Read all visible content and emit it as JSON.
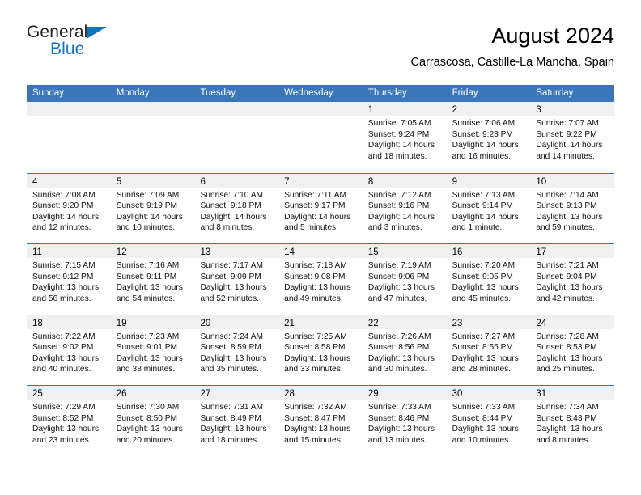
{
  "brand": {
    "name_top": "General",
    "name_bottom": "Blue",
    "accent_color": "#1275bc",
    "text_color": "#231f20"
  },
  "header": {
    "title": "August 2024",
    "subtitle": "Carrascosa, Castille-La Mancha, Spain"
  },
  "theme": {
    "header_row_color": "#3A76B8",
    "day_band_color": "#f0f0f0",
    "row_divider_color": "#3A76B8",
    "page_background": "#ffffff"
  },
  "weekdays": [
    "Sunday",
    "Monday",
    "Tuesday",
    "Wednesday",
    "Thursday",
    "Friday",
    "Saturday"
  ],
  "weeks": [
    [
      {
        "day": "",
        "lines": []
      },
      {
        "day": "",
        "lines": []
      },
      {
        "day": "",
        "lines": []
      },
      {
        "day": "",
        "lines": []
      },
      {
        "day": "1",
        "lines": [
          "Sunrise: 7:05 AM",
          "Sunset: 9:24 PM",
          "Daylight: 14 hours",
          "and 18 minutes."
        ]
      },
      {
        "day": "2",
        "lines": [
          "Sunrise: 7:06 AM",
          "Sunset: 9:23 PM",
          "Daylight: 14 hours",
          "and 16 minutes."
        ]
      },
      {
        "day": "3",
        "lines": [
          "Sunrise: 7:07 AM",
          "Sunset: 9:22 PM",
          "Daylight: 14 hours",
          "and 14 minutes."
        ]
      }
    ],
    [
      {
        "day": "4",
        "lines": [
          "Sunrise: 7:08 AM",
          "Sunset: 9:20 PM",
          "Daylight: 14 hours",
          "and 12 minutes."
        ]
      },
      {
        "day": "5",
        "lines": [
          "Sunrise: 7:09 AM",
          "Sunset: 9:19 PM",
          "Daylight: 14 hours",
          "and 10 minutes."
        ]
      },
      {
        "day": "6",
        "lines": [
          "Sunrise: 7:10 AM",
          "Sunset: 9:18 PM",
          "Daylight: 14 hours",
          "and 8 minutes."
        ]
      },
      {
        "day": "7",
        "lines": [
          "Sunrise: 7:11 AM",
          "Sunset: 9:17 PM",
          "Daylight: 14 hours",
          "and 5 minutes."
        ]
      },
      {
        "day": "8",
        "lines": [
          "Sunrise: 7:12 AM",
          "Sunset: 9:16 PM",
          "Daylight: 14 hours",
          "and 3 minutes."
        ]
      },
      {
        "day": "9",
        "lines": [
          "Sunrise: 7:13 AM",
          "Sunset: 9:14 PM",
          "Daylight: 14 hours",
          "and 1 minute."
        ]
      },
      {
        "day": "10",
        "lines": [
          "Sunrise: 7:14 AM",
          "Sunset: 9:13 PM",
          "Daylight: 13 hours",
          "and 59 minutes."
        ]
      }
    ],
    [
      {
        "day": "11",
        "lines": [
          "Sunrise: 7:15 AM",
          "Sunset: 9:12 PM",
          "Daylight: 13 hours",
          "and 56 minutes."
        ]
      },
      {
        "day": "12",
        "lines": [
          "Sunrise: 7:16 AM",
          "Sunset: 9:11 PM",
          "Daylight: 13 hours",
          "and 54 minutes."
        ]
      },
      {
        "day": "13",
        "lines": [
          "Sunrise: 7:17 AM",
          "Sunset: 9:09 PM",
          "Daylight: 13 hours",
          "and 52 minutes."
        ]
      },
      {
        "day": "14",
        "lines": [
          "Sunrise: 7:18 AM",
          "Sunset: 9:08 PM",
          "Daylight: 13 hours",
          "and 49 minutes."
        ]
      },
      {
        "day": "15",
        "lines": [
          "Sunrise: 7:19 AM",
          "Sunset: 9:06 PM",
          "Daylight: 13 hours",
          "and 47 minutes."
        ]
      },
      {
        "day": "16",
        "lines": [
          "Sunrise: 7:20 AM",
          "Sunset: 9:05 PM",
          "Daylight: 13 hours",
          "and 45 minutes."
        ]
      },
      {
        "day": "17",
        "lines": [
          "Sunrise: 7:21 AM",
          "Sunset: 9:04 PM",
          "Daylight: 13 hours",
          "and 42 minutes."
        ]
      }
    ],
    [
      {
        "day": "18",
        "lines": [
          "Sunrise: 7:22 AM",
          "Sunset: 9:02 PM",
          "Daylight: 13 hours",
          "and 40 minutes."
        ]
      },
      {
        "day": "19",
        "lines": [
          "Sunrise: 7:23 AM",
          "Sunset: 9:01 PM",
          "Daylight: 13 hours",
          "and 38 minutes."
        ]
      },
      {
        "day": "20",
        "lines": [
          "Sunrise: 7:24 AM",
          "Sunset: 8:59 PM",
          "Daylight: 13 hours",
          "and 35 minutes."
        ]
      },
      {
        "day": "21",
        "lines": [
          "Sunrise: 7:25 AM",
          "Sunset: 8:58 PM",
          "Daylight: 13 hours",
          "and 33 minutes."
        ]
      },
      {
        "day": "22",
        "lines": [
          "Sunrise: 7:26 AM",
          "Sunset: 8:56 PM",
          "Daylight: 13 hours",
          "and 30 minutes."
        ]
      },
      {
        "day": "23",
        "lines": [
          "Sunrise: 7:27 AM",
          "Sunset: 8:55 PM",
          "Daylight: 13 hours",
          "and 28 minutes."
        ]
      },
      {
        "day": "24",
        "lines": [
          "Sunrise: 7:28 AM",
          "Sunset: 8:53 PM",
          "Daylight: 13 hours",
          "and 25 minutes."
        ]
      }
    ],
    [
      {
        "day": "25",
        "lines": [
          "Sunrise: 7:29 AM",
          "Sunset: 8:52 PM",
          "Daylight: 13 hours",
          "and 23 minutes."
        ]
      },
      {
        "day": "26",
        "lines": [
          "Sunrise: 7:30 AM",
          "Sunset: 8:50 PM",
          "Daylight: 13 hours",
          "and 20 minutes."
        ]
      },
      {
        "day": "27",
        "lines": [
          "Sunrise: 7:31 AM",
          "Sunset: 8:49 PM",
          "Daylight: 13 hours",
          "and 18 minutes."
        ]
      },
      {
        "day": "28",
        "lines": [
          "Sunrise: 7:32 AM",
          "Sunset: 8:47 PM",
          "Daylight: 13 hours",
          "and 15 minutes."
        ]
      },
      {
        "day": "29",
        "lines": [
          "Sunrise: 7:33 AM",
          "Sunset: 8:46 PM",
          "Daylight: 13 hours",
          "and 13 minutes."
        ]
      },
      {
        "day": "30",
        "lines": [
          "Sunrise: 7:33 AM",
          "Sunset: 8:44 PM",
          "Daylight: 13 hours",
          "and 10 minutes."
        ]
      },
      {
        "day": "31",
        "lines": [
          "Sunrise: 7:34 AM",
          "Sunset: 8:43 PM",
          "Daylight: 13 hours",
          "and 8 minutes."
        ]
      }
    ]
  ]
}
